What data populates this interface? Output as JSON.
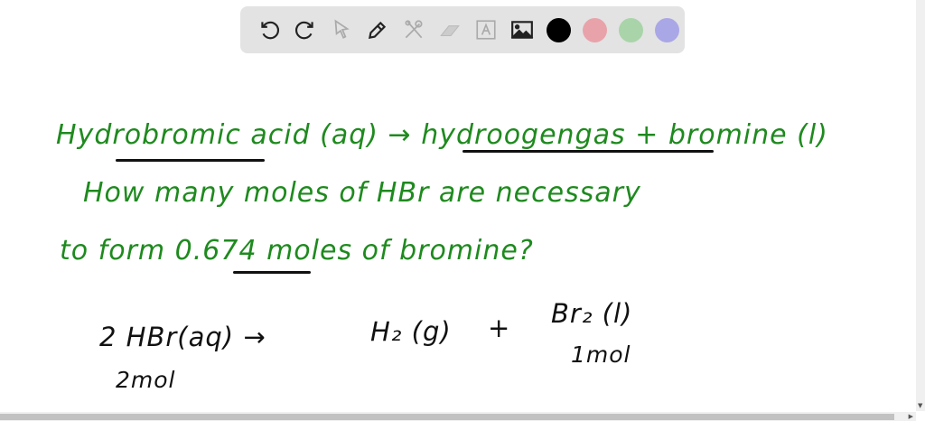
{
  "toolbar": {
    "tools": [
      "undo-icon",
      "redo-icon",
      "select-icon",
      "pen-icon",
      "tools-icon",
      "eraser-icon",
      "text-icon",
      "image-icon"
    ],
    "colors": [
      "#000000",
      "#e8a3aa",
      "#a9d4a9",
      "#aaa7e6"
    ]
  },
  "board": {
    "line1": "Hydrobromic acid (aq) → hydroogengas + bromine (l)",
    "line2": "How many moles of HBr are necessary",
    "line3": "to form 0.674 moles of bromine?",
    "eq_left": "2 HBr(aq) →",
    "eq_mid": "H₂ (g)",
    "eq_plus": "+",
    "eq_right": "Br₂ (l)",
    "mol_left": "2mol",
    "mol_right": "1mol"
  },
  "ink_color": "#1e8a1e"
}
